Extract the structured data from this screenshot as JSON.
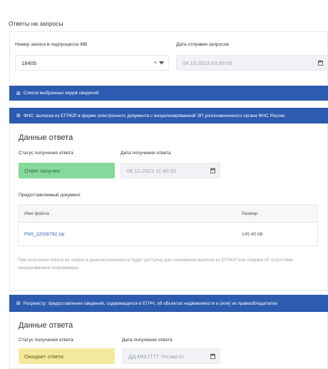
{
  "page": {
    "title": "Ответы на запросы"
  },
  "record": {
    "number_label": "Номер записи в подпроцессе МВ",
    "number_value": "18405",
    "clear_glyph": "×",
    "send_date_label": "Дата отправки запросов",
    "send_date_value": "04.10.2023 03:59:06"
  },
  "bars": {
    "selected_types": "Список выбранных видов сведений",
    "fns": "ФНС: выписка из ЕГРЮЛ в форме электронного документа с визуализированной ЭП уполномоченного органа ФНС России",
    "rosreestr": "Росреестр: предоставление сведений, содержащихся в ЕГРН, об объектах недвижимости и (или) их правообладателях",
    "expand_glyph": "⊞"
  },
  "fns_response": {
    "title": "Данные ответа",
    "status_label": "Статус получения ответа",
    "status_value": "Ответ получен",
    "date_label": "Дата получения ответа",
    "date_value": "06.10.2023 11:40:32",
    "doc_label": "Предоставляемый документ",
    "table": {
      "col_file": "Имя файла",
      "col_size": "Размер",
      "rows": [
        {
          "file": "FNS_22026792.zip",
          "size": "145.40 kB"
        }
      ]
    },
    "note": "При получении ответа на запрос в данном компоненте будет доступна для скачивания выписка из ЕГРЮЛ или справка об отсутствии запрашиваемой информации"
  },
  "rosreestr_response": {
    "title": "Данные ответа",
    "status_label": "Статус получения ответа",
    "status_value": "Ожидает ответа",
    "date_label": "Дата получения ответа",
    "date_placeholder": "ДД.ММ.ГГГГ ЧЧ:мм:сс"
  },
  "colors": {
    "accent": "#2d5bb0",
    "status_received": "#86d99a",
    "status_pending": "#f3e99d"
  },
  "icons": {
    "calendar": "calendar-icon",
    "dropdown": "chevron-down-icon",
    "clear": "clear-icon",
    "expand": "expand-icon"
  }
}
